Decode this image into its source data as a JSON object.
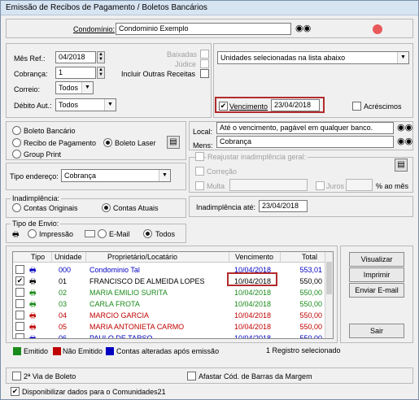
{
  "window": {
    "title": "Emissão de Recibos de Pagamento / Boletos Bancários"
  },
  "condominio": {
    "label": "Condomínio:",
    "value": "Condominio Exemplo"
  },
  "icons": {
    "search": "binoculars-icon",
    "run": "play-icon",
    "printer": "printer-icon",
    "config": "settings-icon"
  },
  "filters": {
    "mes_ref_label": "Mês Ref.:",
    "mes_ref_value": "04/2018",
    "cobranca_label": "Cobrança:",
    "cobranca_value": "1",
    "correio_label": "Correio:",
    "correio_value": "Todos",
    "debito_label": "Débito Aut.:",
    "debito_value": "Todos",
    "baixadas_label": "Baixadas",
    "judice_label": "Júdice",
    "outras_label": "Incluir Outras Receitas"
  },
  "unidades": {
    "select_value": "Unidades selecionadas na lista abaixo",
    "vencimento_label": "Vencimento",
    "vencimento_value": "23/04/2018",
    "acrescimos_label": "Acréscimos"
  },
  "tipo_doc": {
    "boleto_bancario": "Boleto Bancário",
    "recibo": "Recibo de Pagamento",
    "boleto_laser": "Boleto Laser",
    "group_print": "Group Print"
  },
  "local": {
    "label": "Local:",
    "value": "Até o vencimento, pagável em qualquer banco."
  },
  "mens": {
    "label": "Mens:",
    "value": "Cobrança"
  },
  "endereco": {
    "label": "Tipo endereço:",
    "value": "Cobrança"
  },
  "reajustar": {
    "title": "Reajustar inadimplência geral:",
    "correcao": "Correção",
    "multa": "Multa",
    "juros": "Juros",
    "juros_unit": "% ao mês"
  },
  "inadimplencia": {
    "title": "Inadimplência:",
    "originais": "Contas Originais",
    "atuais": "Contas Atuais",
    "ate_label": "Inadimplência até:",
    "ate_value": "23/04/2018"
  },
  "envio": {
    "title": "Tipo de Envio:",
    "impressao": "Impressão",
    "email": "E-Mail",
    "todos": "Todos"
  },
  "table": {
    "headers": [
      "Tipo",
      "Unidade",
      "Proprietário/Locatário",
      "Vencimento",
      "Total"
    ],
    "rows": [
      {
        "unidade": "000",
        "nome": "Condominio Tal",
        "venc": "10/04/2018",
        "total": "553,01",
        "color": "#0000c0",
        "checked": false
      },
      {
        "unidade": "01",
        "nome": "FRANCISCO DE ALMEIDA LOPES",
        "venc": "10/04/2018",
        "total": "550,00",
        "color": "#000000",
        "checked": true
      },
      {
        "unidade": "02",
        "nome": "MARIA EMILIO SURITA",
        "venc": "10/04/2018",
        "total": "550,00",
        "color": "#1a8a1a",
        "checked": false
      },
      {
        "unidade": "03",
        "nome": "CARLA FROTA",
        "venc": "10/04/2018",
        "total": "550,00",
        "color": "#1a8a1a",
        "checked": false
      },
      {
        "unidade": "04",
        "nome": "MARCIO GARCIA",
        "venc": "10/04/2018",
        "total": "550,00",
        "color": "#c00000",
        "checked": false
      },
      {
        "unidade": "05",
        "nome": "MARIA ANTONIETA CARMO",
        "venc": "10/04/2018",
        "total": "550,00",
        "color": "#c00000",
        "checked": false
      },
      {
        "unidade": "06",
        "nome": "PAULO DE TARSO",
        "venc": "10/04/2018",
        "total": "550,00",
        "color": "#0000c0",
        "checked": false
      }
    ]
  },
  "buttons": {
    "visualizar": "Visualizar",
    "imprimir": "Imprimir",
    "enviar": "Enviar E-mail",
    "sair": "Sair"
  },
  "legend": {
    "emitido": "Emitido",
    "nao_emitido": "Não Emitido",
    "alteradas": "Contas alteradas após emissão",
    "selected": "1 Registro selecionado",
    "colors": {
      "emitido": "#1a8a1a",
      "nao_emitido": "#c00000",
      "alteradas": "#0000c0"
    }
  },
  "options": {
    "segunda_via": "2ª Via de Boleto",
    "afastar": "Afastar Cód. de Barras da Margem",
    "disponibilizar": "Disponibilizar dados para o Comunidades21"
  }
}
